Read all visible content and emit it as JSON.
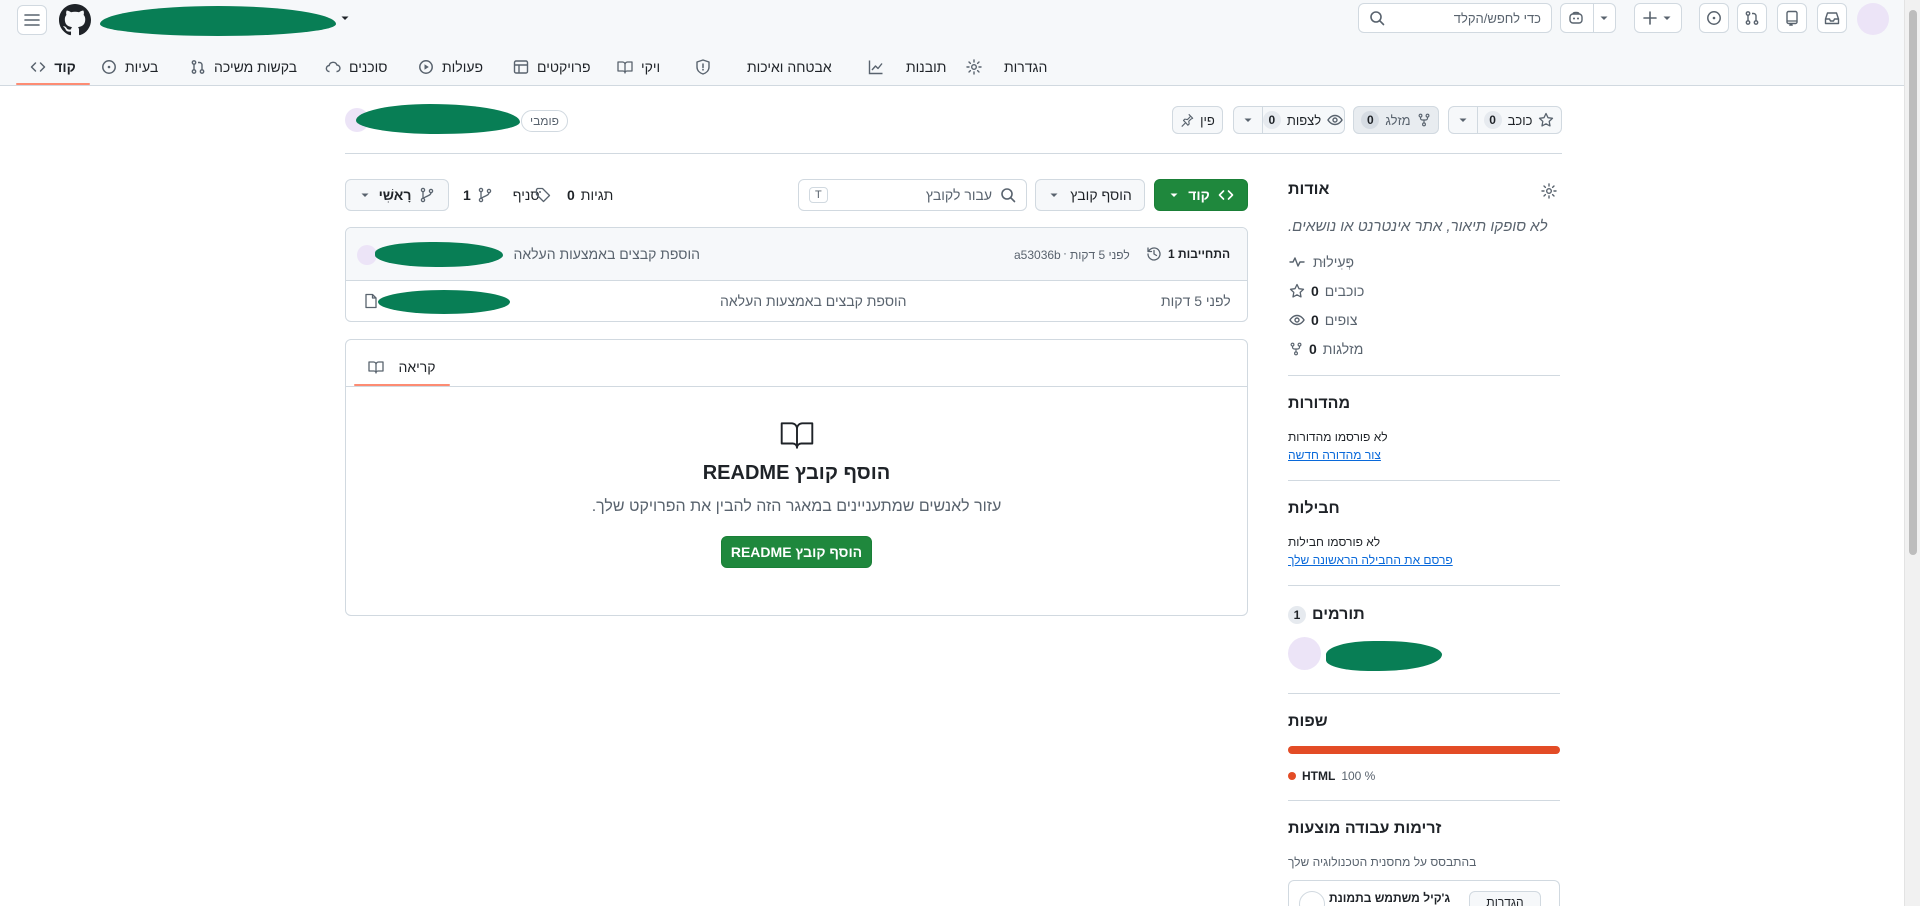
{
  "header": {
    "search_placeholder": "כדי לחפש/הקלד",
    "search_key": "/"
  },
  "repo_nav": {
    "tabs": [
      {
        "label": "קוד"
      },
      {
        "label": "בעיות"
      },
      {
        "label": "בקשות משיכה"
      },
      {
        "label": "סוכנים"
      },
      {
        "label": "פעולות"
      },
      {
        "label": "פרויקטים"
      },
      {
        "label": "ויקי"
      },
      {
        "label": "אבטחה ואיכות"
      },
      {
        "label": "תובנות"
      },
      {
        "label": "הגדרות"
      }
    ]
  },
  "repo_header": {
    "visibility": "פומבי",
    "pin_label": "פין",
    "watch_label": "לצפות",
    "watch_count": "0",
    "fork_label": "מזלג",
    "fork_count": "0",
    "star_label": "כוכב",
    "star_count": "0"
  },
  "toolbar": {
    "branch_label": "רָאשִׁי",
    "branches_count": "1",
    "branches_label": "סניף",
    "tags_count": "0",
    "tags_label": "תגיות",
    "goto_placeholder": "עבור לקובץ",
    "goto_key": "T",
    "add_file_label": "הוסף קובץ",
    "code_label": "קוד"
  },
  "commit_box": {
    "message": "הוספת קבצים באמצעות העלאה",
    "sha": "a53036b",
    "time": "לפני 5 דקות",
    "commits_label": "1 התחייבות"
  },
  "files": [
    {
      "message": "הוספת קבצים באמצעות העלאה",
      "time": "לפני 5 דקות"
    }
  ],
  "readme": {
    "tab_label": "קריאה",
    "title": "הוסף קובץ README",
    "description": "עזור לאנשים שמתעניינים במאגר הזה להבין את הפרויקט שלך.",
    "button_label": "הוסף קובץ README"
  },
  "about": {
    "title": "אודות",
    "description": "לא סופקו תיאור, אתר אינטרנט או נושאים.",
    "activity_label": "פְּעִילוּת",
    "stars_count": "0",
    "stars_label": "כוכבים",
    "watchers_count": "0",
    "watchers_label": "צופים",
    "forks_count": "0",
    "forks_label": "מזלגות"
  },
  "releases": {
    "title": "מהדורות",
    "none_text": "לא פורסמו מהדורות",
    "create_link": "צור מהדורה חדשה"
  },
  "packages": {
    "title": "חבילות",
    "none_text": "לא פורסמו חבילות",
    "publish_link": "פרסם את החבילה הראשונה שלך"
  },
  "contributors": {
    "title": "תורמים",
    "count": "1"
  },
  "languages": {
    "title": "שפות",
    "items": [
      {
        "name": "HTML",
        "percent": "100 %",
        "value": 100,
        "color": "#e34c26"
      }
    ]
  },
  "workflows": {
    "title": "זרימות עבודה מוצעות",
    "description": "בהתבסס על מחסנית הטכנולוגיה שלך",
    "item_title": "ג'קיל משתמש בתמונת",
    "configure_label": "הגדרות"
  },
  "colors": {
    "accent_underline": "#fd8c73",
    "primary_green": "#1f883d",
    "redaction": "#087e55"
  }
}
